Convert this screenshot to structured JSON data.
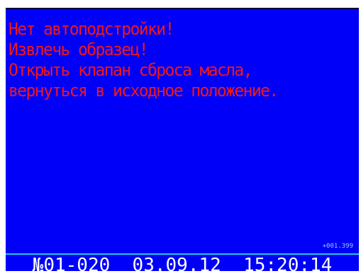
{
  "display": {
    "background_color": "#0000f8",
    "message_color": "#f01818",
    "messages": [
      "Нет автоподстройки!",
      "Извлечь образец!",
      "Открыть клапан сброса масла,",
      "вернуться в исходное положение."
    ],
    "counter": "+001.399"
  },
  "status_bar": {
    "accent_color": "#27c6e8",
    "text": "№01-020  03.09.12  15:20:14"
  }
}
